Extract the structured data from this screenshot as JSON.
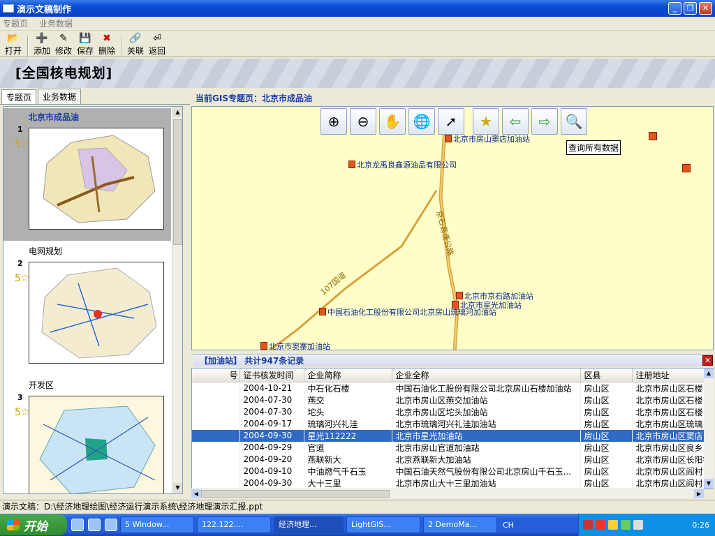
{
  "window": {
    "title": "演示文稿制作"
  },
  "menu": [
    "专题页",
    "业务数据"
  ],
  "toolbar": [
    {
      "label": "打开",
      "icon": "folder-open-icon",
      "glyph": "📂"
    },
    {
      "label": "添加",
      "icon": "add-icon",
      "glyph": "➕"
    },
    {
      "label": "修改",
      "icon": "edit-icon",
      "glyph": "✎"
    },
    {
      "label": "保存",
      "icon": "save-icon",
      "glyph": "💾"
    },
    {
      "label": "删除",
      "icon": "delete-icon",
      "glyph": "✖"
    },
    {
      "label": "关联",
      "icon": "link-icon",
      "glyph": "🔗"
    },
    {
      "label": "返回",
      "icon": "return-icon",
      "glyph": "⏎"
    }
  ],
  "banner": {
    "title": "[全国核电规划]"
  },
  "left_tabs": [
    "专题页",
    "业务数据"
  ],
  "slides": [
    {
      "num": "1",
      "title": "北京市成品油",
      "selected": true
    },
    {
      "num": "2",
      "title": "电网规划",
      "selected": false
    },
    {
      "num": "3",
      "title": "开发区",
      "selected": false
    }
  ],
  "gis": {
    "current_label": "当前GIS专题页：北京市成品油",
    "tooltip": "查询所有数据",
    "map_tools": [
      {
        "name": "zoom-in-icon",
        "glyph": "⊕"
      },
      {
        "name": "zoom-out-icon",
        "glyph": "⊖"
      },
      {
        "name": "pan-hand-icon",
        "glyph": "✋"
      },
      {
        "name": "globe-icon",
        "glyph": "🌐"
      },
      {
        "name": "select-arrow-icon",
        "glyph": "➚"
      },
      {
        "name": "bookmark-icon",
        "glyph": "★"
      },
      {
        "name": "back-icon",
        "glyph": "⇦"
      },
      {
        "name": "forward-icon",
        "glyph": "⇨"
      },
      {
        "name": "query-all-icon",
        "glyph": "🔍"
      }
    ],
    "pois": [
      {
        "text": "北京市房山窦店加油站"
      },
      {
        "text": "北京龙禹良鑫源油品有限公司"
      },
      {
        "text": "北京市京石路加油站"
      },
      {
        "text": "北京市星光加油站"
      },
      {
        "text": "中国石油化工股份有限公司北京房山琉璃河加油站"
      },
      {
        "text": "北京市窦寨加油站"
      }
    ],
    "roads": [
      "京石高速公路",
      "107国道"
    ]
  },
  "grid": {
    "header": "【加油站】 共计947条记录",
    "columns": [
      "号",
      "证书核发时间",
      "企业简称",
      "企业全称",
      "区县",
      "注册地址"
    ],
    "rows": [
      [
        "",
        "2004-10-21",
        "中石化石楼",
        "中国石油化工股份有限公司北京房山石楼加油站",
        "房山区",
        "北京市房山区石楼"
      ],
      [
        "",
        "2004-07-30",
        "燕交",
        "北京市房山区燕交加油站",
        "房山区",
        "北京市房山区石楼"
      ],
      [
        "",
        "2004-07-30",
        "坨头",
        "北京市房山区坨头加油站",
        "房山区",
        "北京市房山区石楼"
      ],
      [
        "",
        "2004-09-17",
        "琉璃河兴礼洼",
        "北京市琉璃河兴礼洼加油站",
        "房山区",
        "北京市房山区琉璃"
      ],
      [
        "",
        "2004-09-30",
        "星光112222",
        "北京市星光加油站",
        "房山区",
        "北京市房山区窦店"
      ],
      [
        "",
        "2004-09-29",
        "官道",
        "北京市房山官道加油站",
        "房山区",
        "北京市房山区良乡"
      ],
      [
        "",
        "2004-09-20",
        "燕联新大",
        "北京燕联新大加油站",
        "房山区",
        "北京市房山区长阳镇"
      ],
      [
        "",
        "2004-09-10",
        "中油燃气千石玉",
        "中国石油天然气股份有限公司北京房山千石玉...",
        "房山区",
        "北京市房山区阎村"
      ],
      [
        "",
        "2004-09-30",
        "大十三里",
        "北京市房山大十三里加油站",
        "房山区",
        "北京市房山区阎村"
      ]
    ],
    "selected_row": 4
  },
  "status": {
    "text": "演示文稿：D:\\经济地理绘图\\经济运行演示系统\\经济地理演示汇报.ppt"
  },
  "taskbar": {
    "start": "开始",
    "tasks": [
      "5 Window...",
      "122.122....",
      "经济地理...",
      "LightGIS...",
      "2 DemoMa..."
    ],
    "lang": "CH",
    "clock": "0:26"
  }
}
